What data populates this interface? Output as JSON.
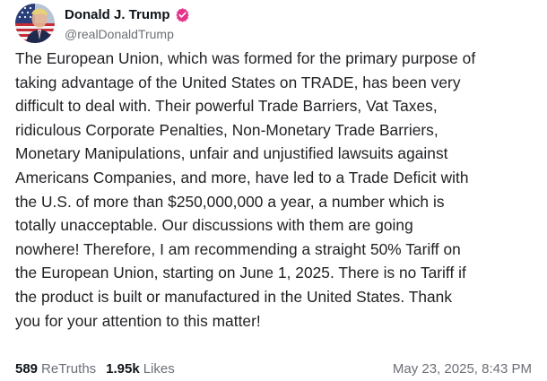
{
  "author": {
    "display_name": "Donald J. Trump",
    "handle": "@realDonaldTrump",
    "verified": true,
    "avatar_icon": "american-flag-portrait-avatar"
  },
  "post": {
    "lines": [
      "The European Union, which was formed for the primary purpose of",
      "taking advantage of the United States on TRADE, has been very",
      "difficult to deal with. Their powerful Trade Barriers, Vat Taxes,",
      "ridiculous Corporate Penalties, Non-Monetary Trade Barriers,",
      "Monetary Manipulations, unfair and unjustified lawsuits against",
      "Americans Companies, and more, have led to a Trade Deficit with",
      "the U.S. of more than $250,000,000 a year, a number which is",
      "totally unacceptable. Our discussions with them are going",
      "nowhere! Therefore, I am recommending a straight 50% Tariff on",
      "the European Union, starting on June 1, 2025. There is no Tariff if",
      "the product is built or manufactured in the United States. Thank",
      "you for your attention to this matter!"
    ]
  },
  "stats": {
    "retruths_count": "589",
    "retruths_label": "ReTruths",
    "likes_count": "1.95k",
    "likes_label": "Likes"
  },
  "timestamp": "May 23, 2025, 8:43 PM",
  "colors": {
    "text_primary": "#0f1419",
    "text_secondary": "#6b6f76",
    "verified_badge": "#e5338c",
    "background": "#ffffff"
  }
}
